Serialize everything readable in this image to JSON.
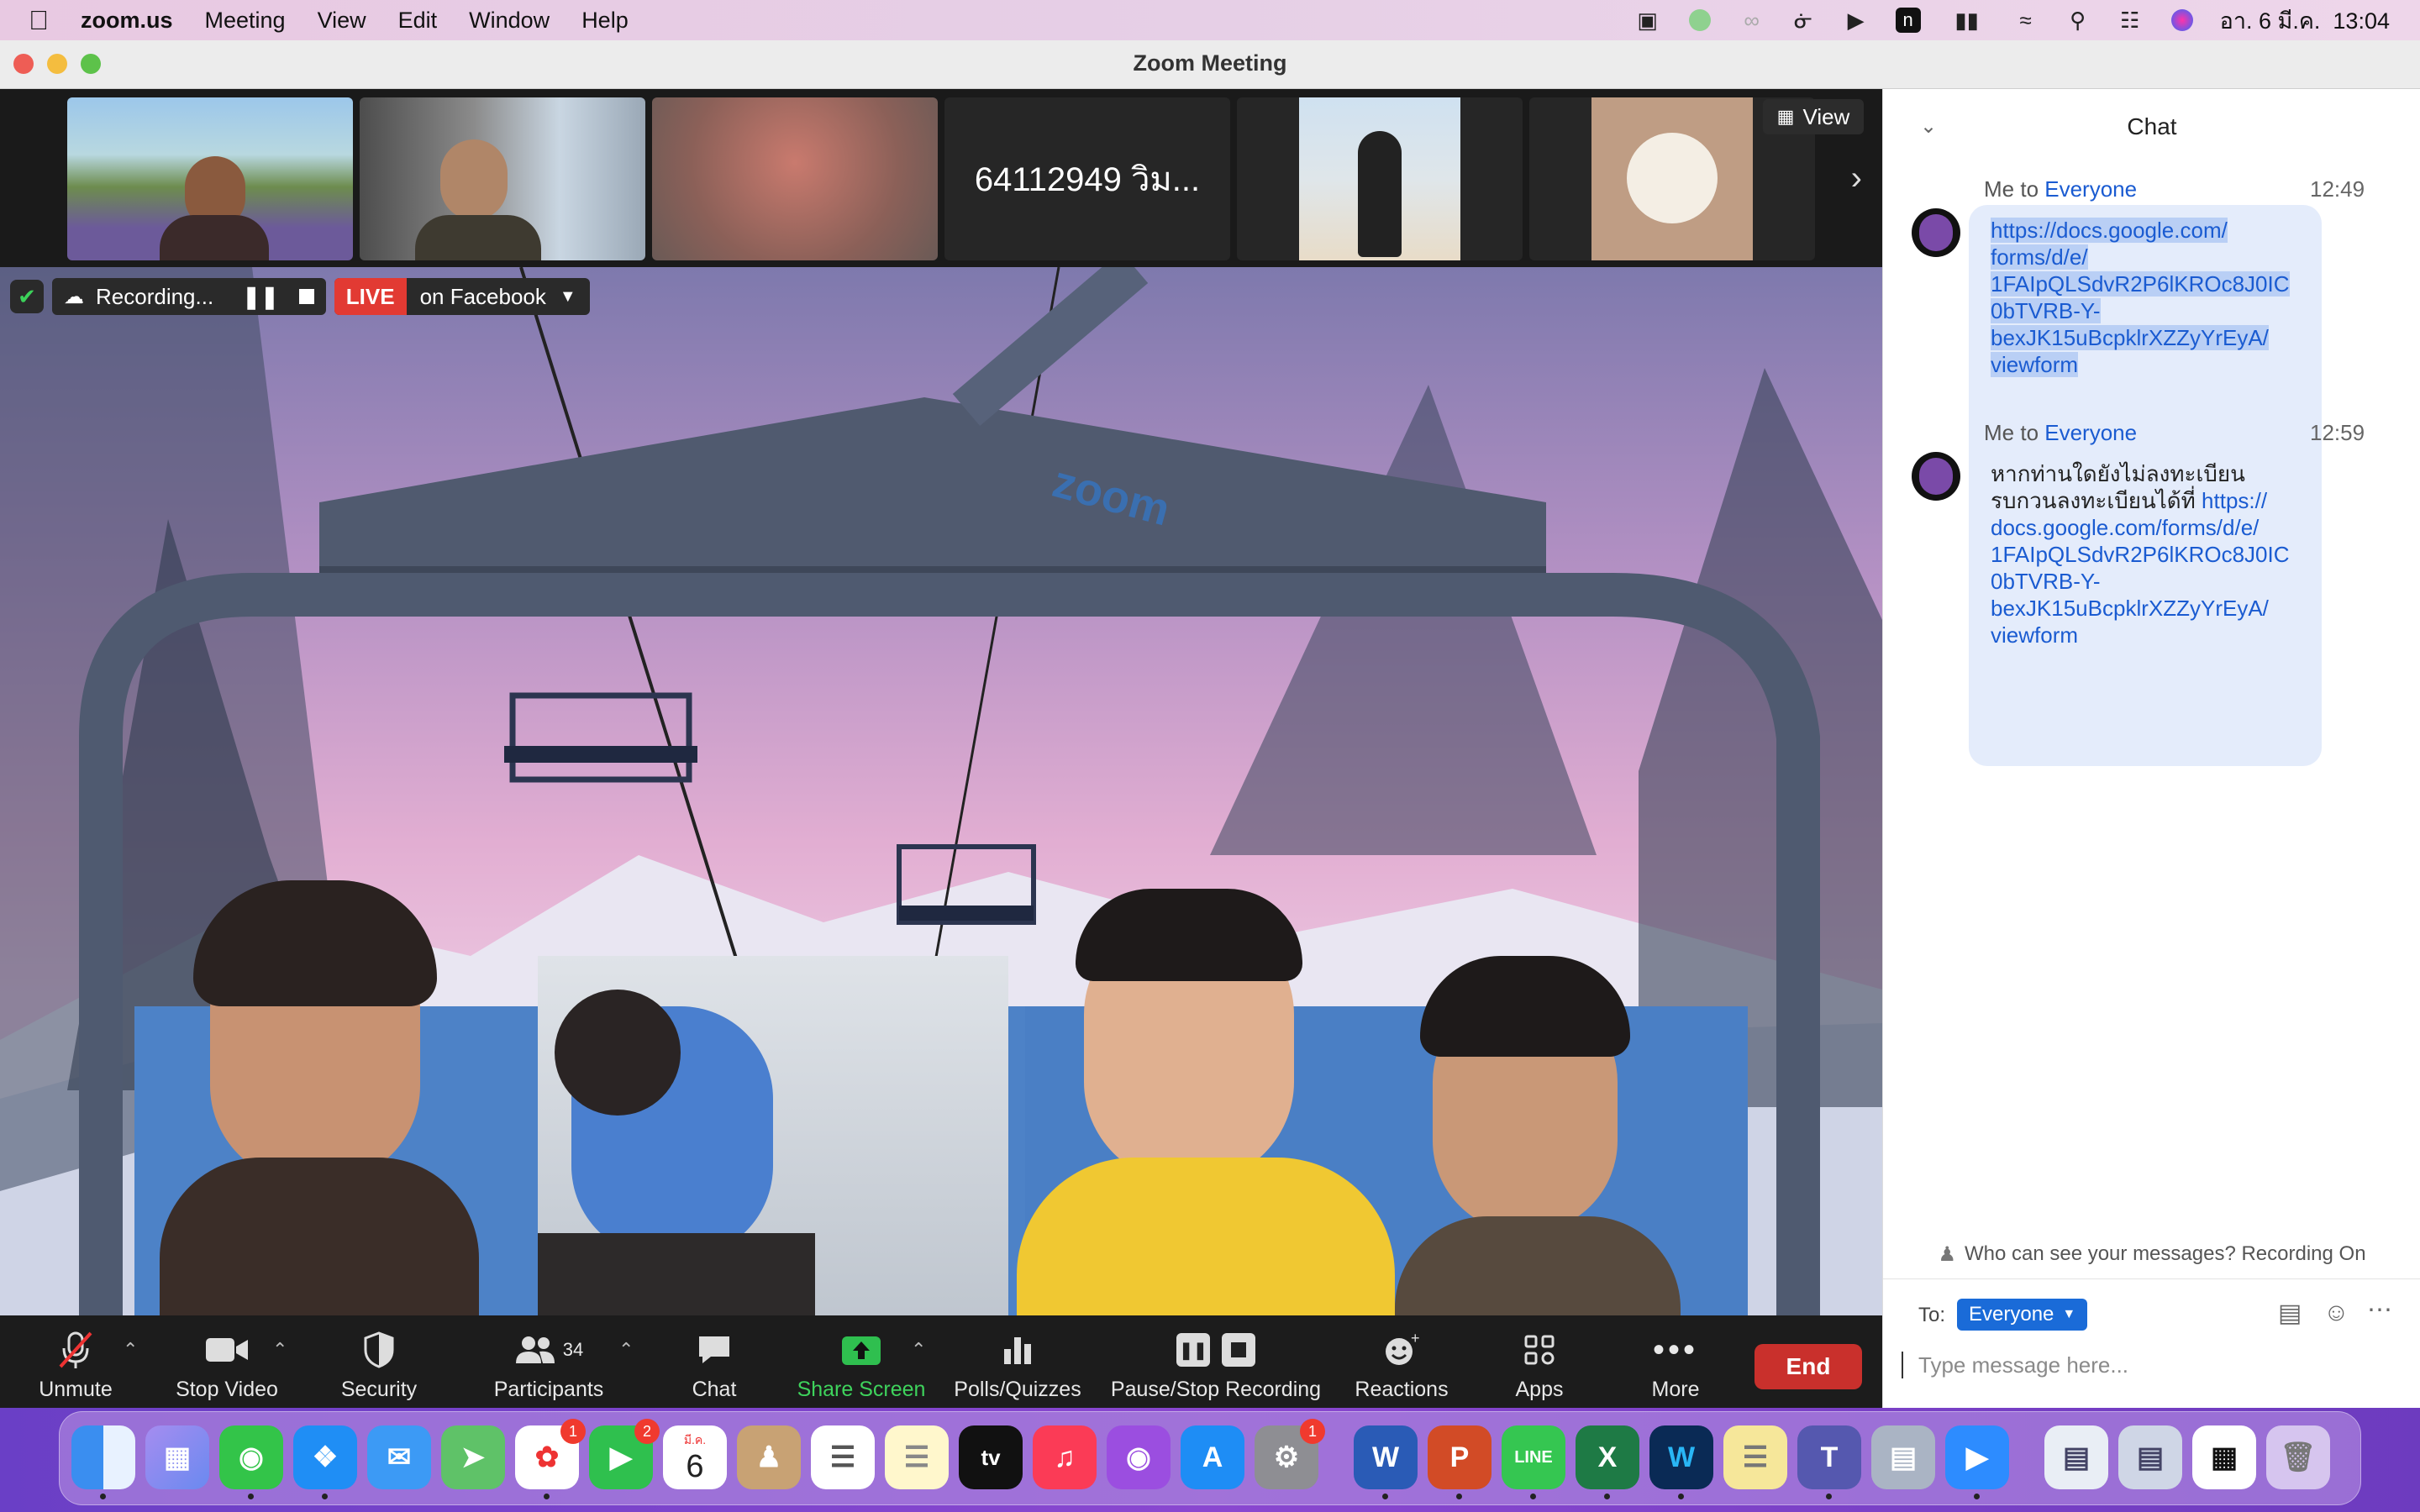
{
  "menubar": {
    "apple": "",
    "app": "zoom.us",
    "items": [
      "Meeting",
      "View",
      "Edit",
      "Window",
      "Help"
    ],
    "clock": "อา. 6 มี.ค.  13:04"
  },
  "window": {
    "title": "Zoom Meeting"
  },
  "strip": {
    "name_tile": "64112949 วิม...",
    "view_label": "View"
  },
  "recording": {
    "label": "Recording...",
    "live_badge": "LIVE",
    "live_target": "on Facebook"
  },
  "toolbar": {
    "unmute": "Unmute",
    "stop_video": "Stop Video",
    "security": "Security",
    "participants": "Participants",
    "participants_count": "34",
    "chat": "Chat",
    "share_screen": "Share Screen",
    "polls": "Polls/Quizzes",
    "pause_stop_recording": "Pause/Stop Recording",
    "reactions": "Reactions",
    "apps": "Apps",
    "more": "More",
    "end": "End"
  },
  "chat": {
    "title": "Chat",
    "messages": [
      {
        "from": "Me to ",
        "to": "Everyone",
        "time": "12:49",
        "lines": [
          "https://docs.google.com/",
          "forms/d/e/",
          "1FAIpQLSdvR2P6lKROc8J0IC",
          "0bTVRB-Y-",
          "bexJK15uBcpklrXZZyYrEyA/",
          "viewform"
        ]
      },
      {
        "from": "Me to ",
        "to": "Everyone",
        "time": "12:59",
        "text_line1": "หากท่านใดยังไม่ลงทะเบียน",
        "text_line2": "รบกวนลงทะเบียนได้ที่ ",
        "link_start": "https://",
        "lines": [
          "docs.google.com/forms/d/e/",
          "1FAIpQLSdvR2P6lKROc8J0IC",
          "0bTVRB-Y-",
          "bexJK15uBcpklrXZZyYrEyA/",
          "viewform"
        ]
      }
    ],
    "who_can_see": "Who can see your messages? Recording On",
    "to_label": "To:",
    "to_value": "Everyone",
    "placeholder": "Type message here..."
  },
  "dock": {
    "calendar_month": "มี.ค.",
    "calendar_day": "6",
    "badges": {
      "photos": "1",
      "facetime": "2",
      "settings": "1"
    }
  }
}
